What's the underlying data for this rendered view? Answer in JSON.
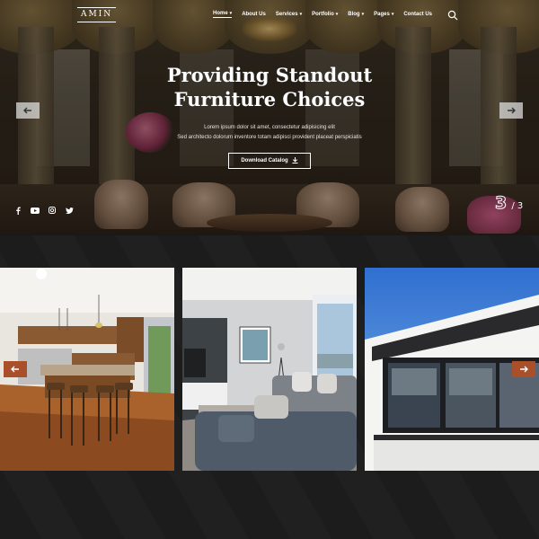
{
  "brand": {
    "logo": "AMIN"
  },
  "nav": {
    "items": [
      {
        "label": "Home",
        "dropdown": true,
        "active": true
      },
      {
        "label": "About Us",
        "dropdown": false
      },
      {
        "label": "Services",
        "dropdown": true
      },
      {
        "label": "Portfolio",
        "dropdown": true
      },
      {
        "label": "Blog",
        "dropdown": true
      },
      {
        "label": "Pages",
        "dropdown": true
      },
      {
        "label": "Contact Us",
        "dropdown": false
      }
    ],
    "search_icon": "search-icon"
  },
  "hero": {
    "title_line1": "Providing Standout",
    "title_line2": "Furniture Choices",
    "subtitle_line1": "Lorem ipsum dolor sit amet, consectetur adipisicing elit",
    "subtitle_line2": "Sed architecto dolorum inventore totam adipisci provident placeat perspiciatis",
    "cta_label": "Download Catalog",
    "cta_icon": "download-icon",
    "slide_current": "3",
    "slide_total": "/ 3",
    "prev_icon": "arrow-left-icon",
    "next_icon": "arrow-right-icon"
  },
  "socials": [
    "facebook-icon",
    "youtube-icon",
    "instagram-icon",
    "twitter-icon"
  ],
  "gallery": {
    "cards": [
      "kitchen",
      "living-room",
      "modern-house"
    ],
    "prev_icon": "arrow-left-icon",
    "next_icon": "arrow-right-icon"
  },
  "colors": {
    "accent": "#a9502a",
    "background": "#1a1a1a"
  }
}
